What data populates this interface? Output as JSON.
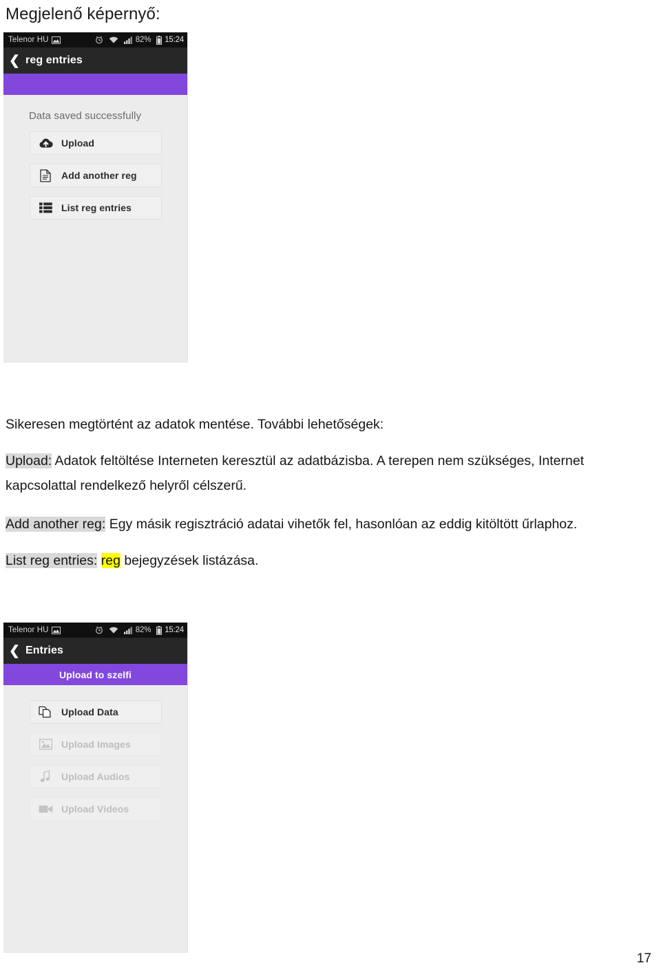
{
  "document": {
    "heading": "Megjelenő képernyő:",
    "page_number": "17"
  },
  "screenshot_one": {
    "statusbar": {
      "carrier": "Telenor HU",
      "carrier_icon": "picture-icon",
      "alarm_icon": "alarm-clock-icon",
      "wifi_icon": "wifi-icon",
      "signal_icon": "signal-bars-icon",
      "battery_percent": "82%",
      "battery_icon": "battery-icon",
      "clock": "15:24"
    },
    "actionbar": {
      "back_icon": "back-chevron-icon",
      "title": "reg entries"
    },
    "purple_bar_label": "",
    "message": "Data saved successfully",
    "buttons": [
      {
        "label": "Upload",
        "icon": "cloud-upload-icon",
        "enabled": true
      },
      {
        "label": "Add another reg",
        "icon": "document-icon",
        "enabled": true
      },
      {
        "label": "List reg entries",
        "icon": "list-icon",
        "enabled": true
      }
    ]
  },
  "screenshot_two": {
    "statusbar": {
      "carrier": "Telenor HU",
      "carrier_icon": "picture-icon",
      "alarm_icon": "alarm-clock-icon",
      "wifi_icon": "wifi-icon",
      "signal_icon": "signal-bars-icon",
      "battery_percent": "82%",
      "battery_icon": "battery-icon",
      "clock": "15:24"
    },
    "actionbar": {
      "back_icon": "back-chevron-icon",
      "title": "Entries"
    },
    "purple_bar_label": "Upload to szelfi",
    "buttons": [
      {
        "label": "Upload Data",
        "icon": "copy-pages-icon",
        "enabled": true
      },
      {
        "label": "Upload Images",
        "icon": "image-icon",
        "enabled": false
      },
      {
        "label": "Upload Audios",
        "icon": "music-note-icon",
        "enabled": false
      },
      {
        "label": "Upload Videos",
        "icon": "video-camera-icon",
        "enabled": false
      }
    ]
  },
  "prose": {
    "paragraph_1": "Sikeresen megtörtént az adatok mentése. További lehetőségek:",
    "paragraph_2": {
      "term": "Upload:",
      "body": " Adatok feltöltése Interneten keresztül az adatbázisba. A terepen nem szükséges, Internet kapcsolattal rendelkező helyről célszerű."
    },
    "paragraph_3": {
      "term": "Add another reg:",
      "body": " Egy másik regisztráció adatai vihetők fel, hasonlóan az eddig kitöltött űrlaphoz."
    },
    "paragraph_4": {
      "term": "List reg entries:",
      "highlight": "reg",
      "body": " bejegyzések listázása."
    }
  },
  "colors": {
    "purple_accent": "#8247dd",
    "statusbar_black": "#101010",
    "actionbar_black": "#272727",
    "screen_gray": "#ececec",
    "highlight_gray": "#d9d9d9",
    "highlight_yellow": "#ffff00"
  }
}
